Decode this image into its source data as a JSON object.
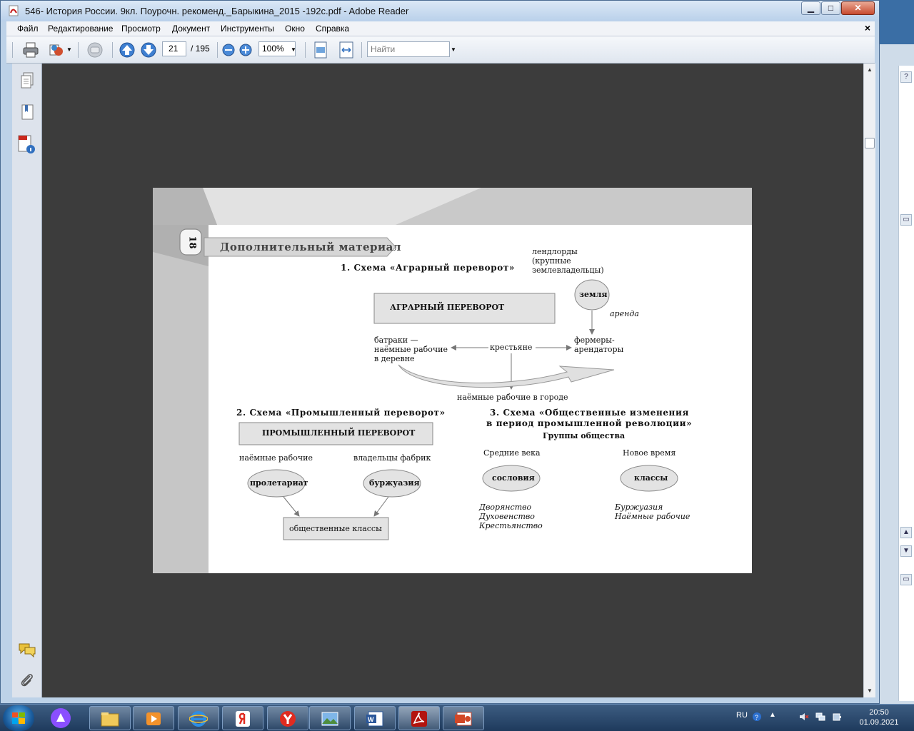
{
  "window": {
    "title": "546- История России. 9кл. Поурочн. рекоменд._Барыкина_2015 -192с.pdf - Adobe Reader",
    "minimize_label": "▁",
    "maximize_label": "□",
    "close_label": "✕"
  },
  "menu": {
    "items": [
      "Файл",
      "Редактирование",
      "Просмотр",
      "Документ",
      "Инструменты",
      "Окно",
      "Справка"
    ],
    "close_label": "×"
  },
  "toolbar": {
    "page_current": "21",
    "page_total": "/ 195",
    "zoom": "100%",
    "search_placeholder": "Найти"
  },
  "sidebar": {
    "icons": [
      "pages-icon",
      "bookmarks-icon",
      "document-properties-icon",
      "comments-icon",
      "attachments-icon"
    ]
  },
  "page": {
    "page_number": "18",
    "header": "Дополнительный материал",
    "scheme1": {
      "title": "1. Схема «Аграрный переворот»",
      "box": "АГРАРНЫЙ ПЕРЕВОРОТ",
      "landlords": [
        "лендлорды",
        "(крупные",
        "землевладельцы)"
      ],
      "land": "земля",
      "rent": "аренда",
      "batraki": [
        "батраки —",
        "наёмные рабочие",
        "в деревне"
      ],
      "peasants": "крестьяне",
      "farmers": [
        "фермеры-",
        "арендаторы"
      ],
      "city_workers": "наёмные рабочие в городе"
    },
    "scheme2": {
      "title": "2. Схема «Промышленный переворот»",
      "box": "ПРОМЫШЛЕННЫЙ ПЕРЕВОРОТ",
      "workers": "наёмные рабочие",
      "owners": "владельцы фабрик",
      "proletariat": "пролетариат",
      "bourgeoisie": "буржуазия",
      "classes": "общественные классы"
    },
    "scheme3": {
      "title": [
        "3. Схема «Общественные изменения",
        "в период промышленной революции»"
      ],
      "subtitle": "Группы общества",
      "middle_ages": "Средние века",
      "new_time": "Новое время",
      "estates": "сословия",
      "classes": "классы",
      "estates_list": [
        "Дворянство",
        "Духовенство",
        "Крестьянство"
      ],
      "classes_list": [
        "Буржуазия",
        "Наёмные рабочие"
      ]
    }
  },
  "taskbar": {
    "apps": [
      "explorer",
      "media-player",
      "internet-explorer",
      "yandex",
      "yandex-browser",
      "photo-viewer",
      "word",
      "adobe-reader",
      "powerpoint"
    ],
    "lang": "RU",
    "time": "20:50",
    "date": "01.09.2021",
    "colors": {
      "taskbar": "#1e3a5c",
      "accent": "#3a6ea5"
    }
  }
}
